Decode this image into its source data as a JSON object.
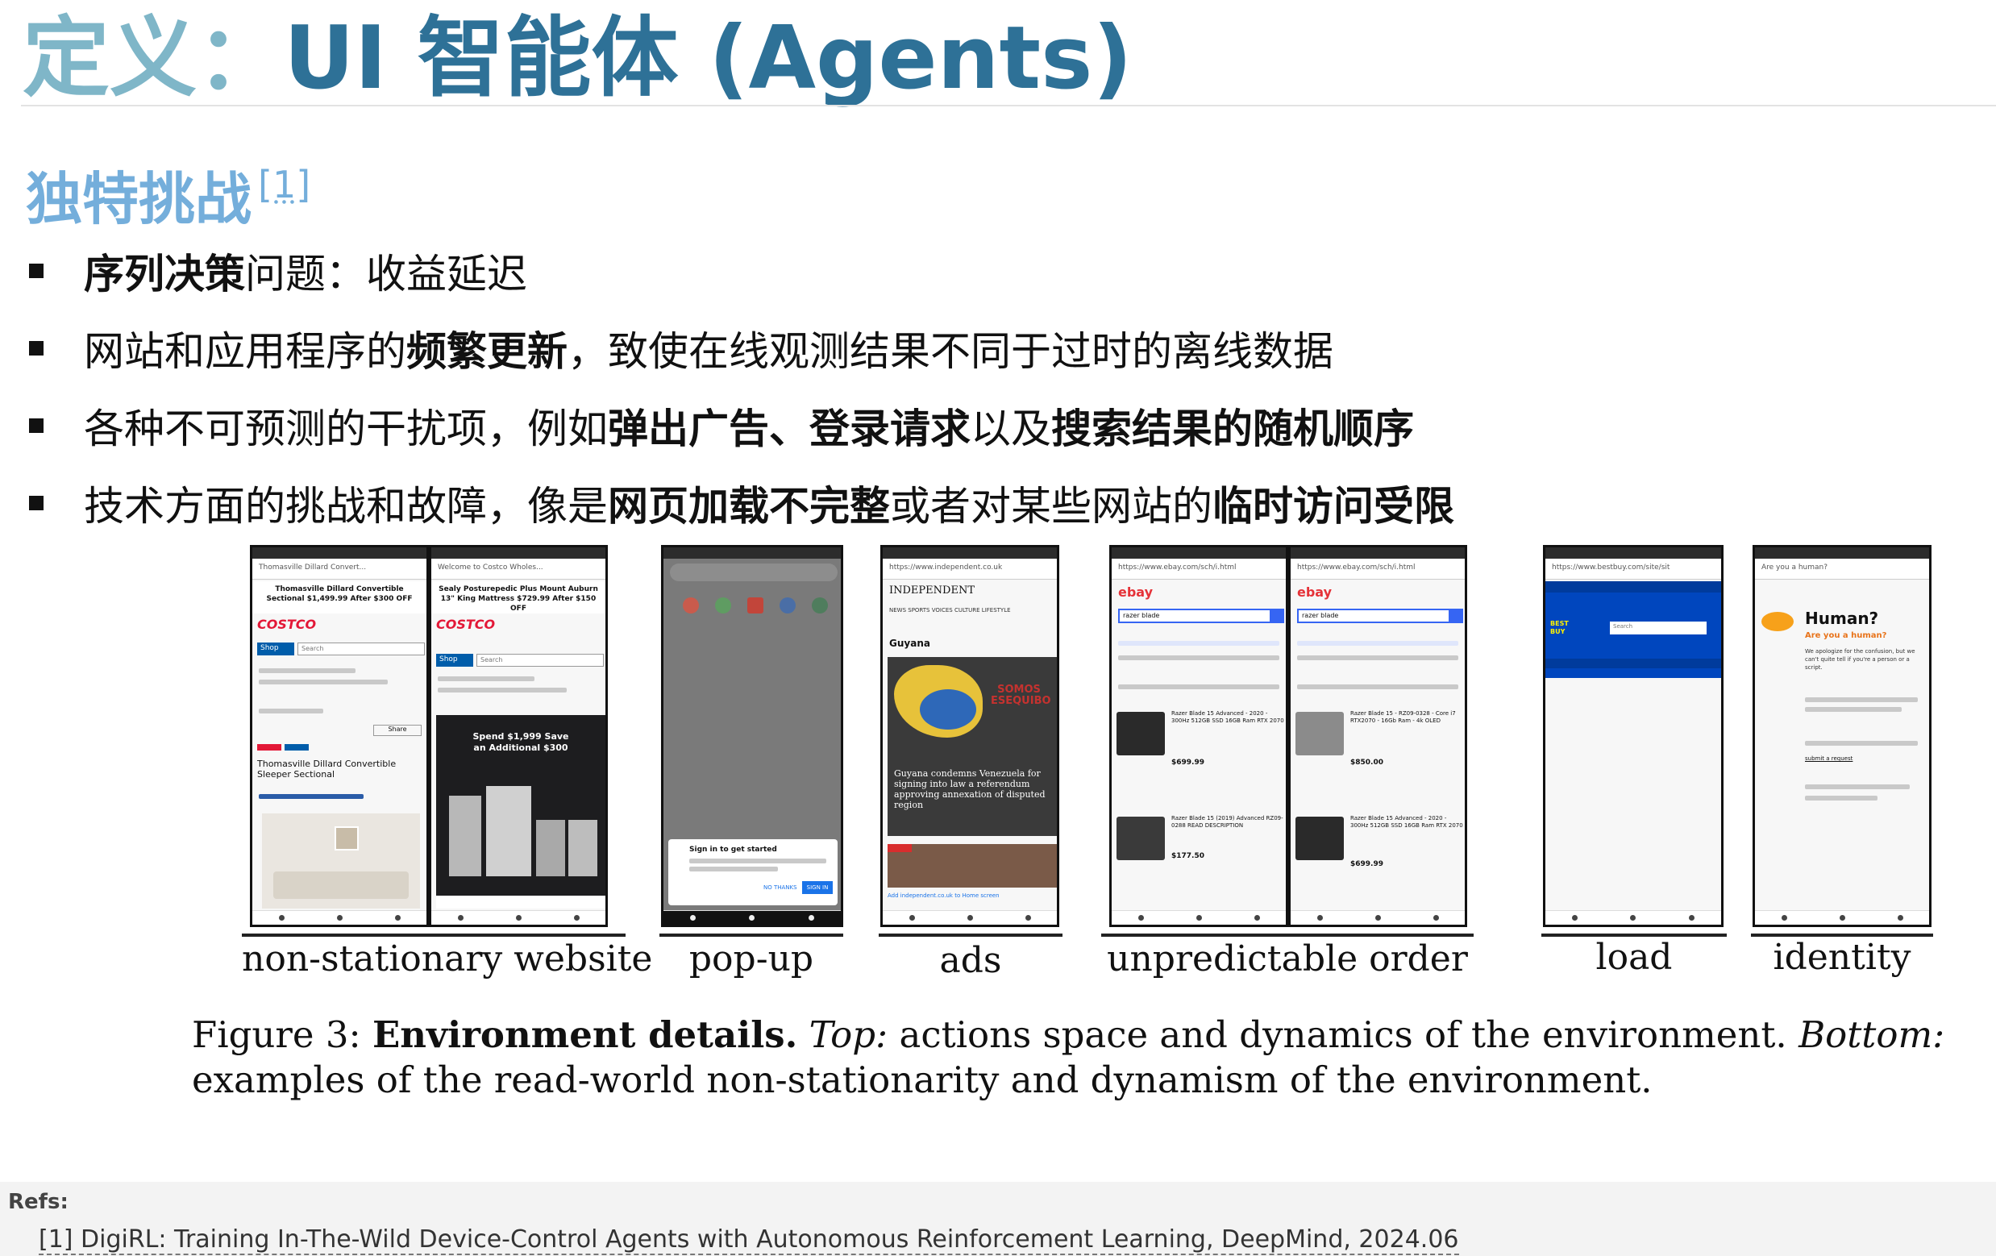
{
  "title": {
    "zh": "定义：",
    "en": "UI 智能体 (Agents)"
  },
  "subtitle": {
    "text": "独特挑战",
    "ref": "[1]"
  },
  "bullets": [
    {
      "parts": [
        {
          "t": "序列决策",
          "b": true
        },
        {
          "t": "问题：收益延迟",
          "b": false
        }
      ]
    },
    {
      "parts": [
        {
          "t": "网站和应用程序的",
          "b": false
        },
        {
          "t": "频繁更新",
          "b": true
        },
        {
          "t": "，致使在线观测结果不同于过时的离线数据",
          "b": false
        }
      ]
    },
    {
      "parts": [
        {
          "t": "各种不可预测的干扰项，例如",
          "b": false
        },
        {
          "t": "弹出广告、登录请求",
          "b": true
        },
        {
          "t": "以及",
          "b": false
        },
        {
          "t": "搜索结果的随机顺序",
          "b": true
        }
      ]
    },
    {
      "parts": [
        {
          "t": "技术方面的挑战和故障，像是",
          "b": false
        },
        {
          "t": "网页加载不完整",
          "b": true
        },
        {
          "t": "或者对某些网站的",
          "b": false
        },
        {
          "t": "临时访问受限",
          "b": true
        }
      ]
    }
  ],
  "figure": {
    "captions": [
      "non-stationary website",
      "pop-up",
      "ads",
      "unpredictable order",
      "load",
      "identity"
    ],
    "screens": {
      "costco1": {
        "url": "Thomasville Dillard Convert...",
        "banner": "Thomasville Dillard Convertible Sectional $1,499.99 After $300 OFF",
        "logo": "COSTCO",
        "shop": "Shop",
        "search": "Search",
        "product": "Thomasville Dillard Convertible Sleeper Sectional",
        "share": "Share"
      },
      "costco2": {
        "url": "Welcome to Costco Wholes...",
        "banner": "Sealy Posturepedic Plus Mount Auburn 13\" King Mattress $729.99 After $150 OFF",
        "logo": "COSTCO",
        "shop": "Shop",
        "search": "Search",
        "promo": "Spend $1,999 Save an Additional $300"
      },
      "popup": {
        "signin": "Sign in to get started",
        "btn1": "NO THANKS",
        "btn2": "SIGN IN"
      },
      "ads": {
        "url": "https://www.independent.co.uk",
        "logo": "INDEPENDENT",
        "nav": "NEWS  SPORTS  VOICES  CULTURE  LIFESTYLE",
        "section": "Guyana",
        "headline": "Guyana condemns Venezuela for signing into law a referendum approving annexation of disputed region",
        "ad": "SOMOS ESEQUIBO",
        "footer": "Add independent.co.uk to Home screen"
      },
      "ebay1": {
        "url": "https://www.ebay.com/sch/i.html",
        "logo": "ebay",
        "search": "razer blade",
        "p1": "Razer Blade 15 Advanced - 2020 - 300Hz 512GB SSD 16GB Ram RTX 2070",
        "price1": "$699.99",
        "p2": "Razer Blade 15 (2019) Advanced RZ09-0288 READ DESCRIPTION",
        "price2": "$177.50"
      },
      "ebay2": {
        "url": "https://www.ebay.com/sch/i.html",
        "logo": "ebay",
        "search": "razer blade",
        "p1": "Razer Blade 15 - RZ09-0328 - Core i7 RTX2070 - 16Gb Ram - 4k OLED",
        "price1": "$850.00",
        "p2": "Razer Blade 15 Advanced - 2020 - 300Hz 512GB SSD 16GB Ram RTX 2070",
        "price2": "$699.99"
      },
      "load": {
        "url": "https://www.bestbuy.com/site/sit",
        "logo": "BEST BUY",
        "search": "Search"
      },
      "identity": {
        "url": "Are you a human?",
        "heading": "Human?",
        "sub": "Are you a human?",
        "body": "We apologize for the confusion, but we can't quite tell if you're a person or a script.",
        "link": "submit a request"
      }
    },
    "caption": {
      "label": "Figure 3:",
      "bold": "Environment details.",
      "top": "Top:",
      "top_text": "actions space and dynamics of the environment.",
      "bottom": "Bottom:",
      "bottom_text": "examples of the read-world non-stationarity and dynamism of the environment."
    }
  },
  "refs": {
    "label": "Refs:",
    "items": [
      "[1] DigiRL: Training In-The-Wild Device-Control Agents with Autonomous Reinforcement Learning, DeepMind, 2024.06"
    ]
  },
  "colors": {
    "title": "#2e7197",
    "title_zh": "#7fb6c8",
    "subtitle": "#74aedb",
    "costco_red": "#e31837",
    "costco_blue": "#005daa",
    "ebay_blue": "#3665f3",
    "bestbuy_blue": "#0046be",
    "bestbuy_yellow": "#fff200"
  }
}
